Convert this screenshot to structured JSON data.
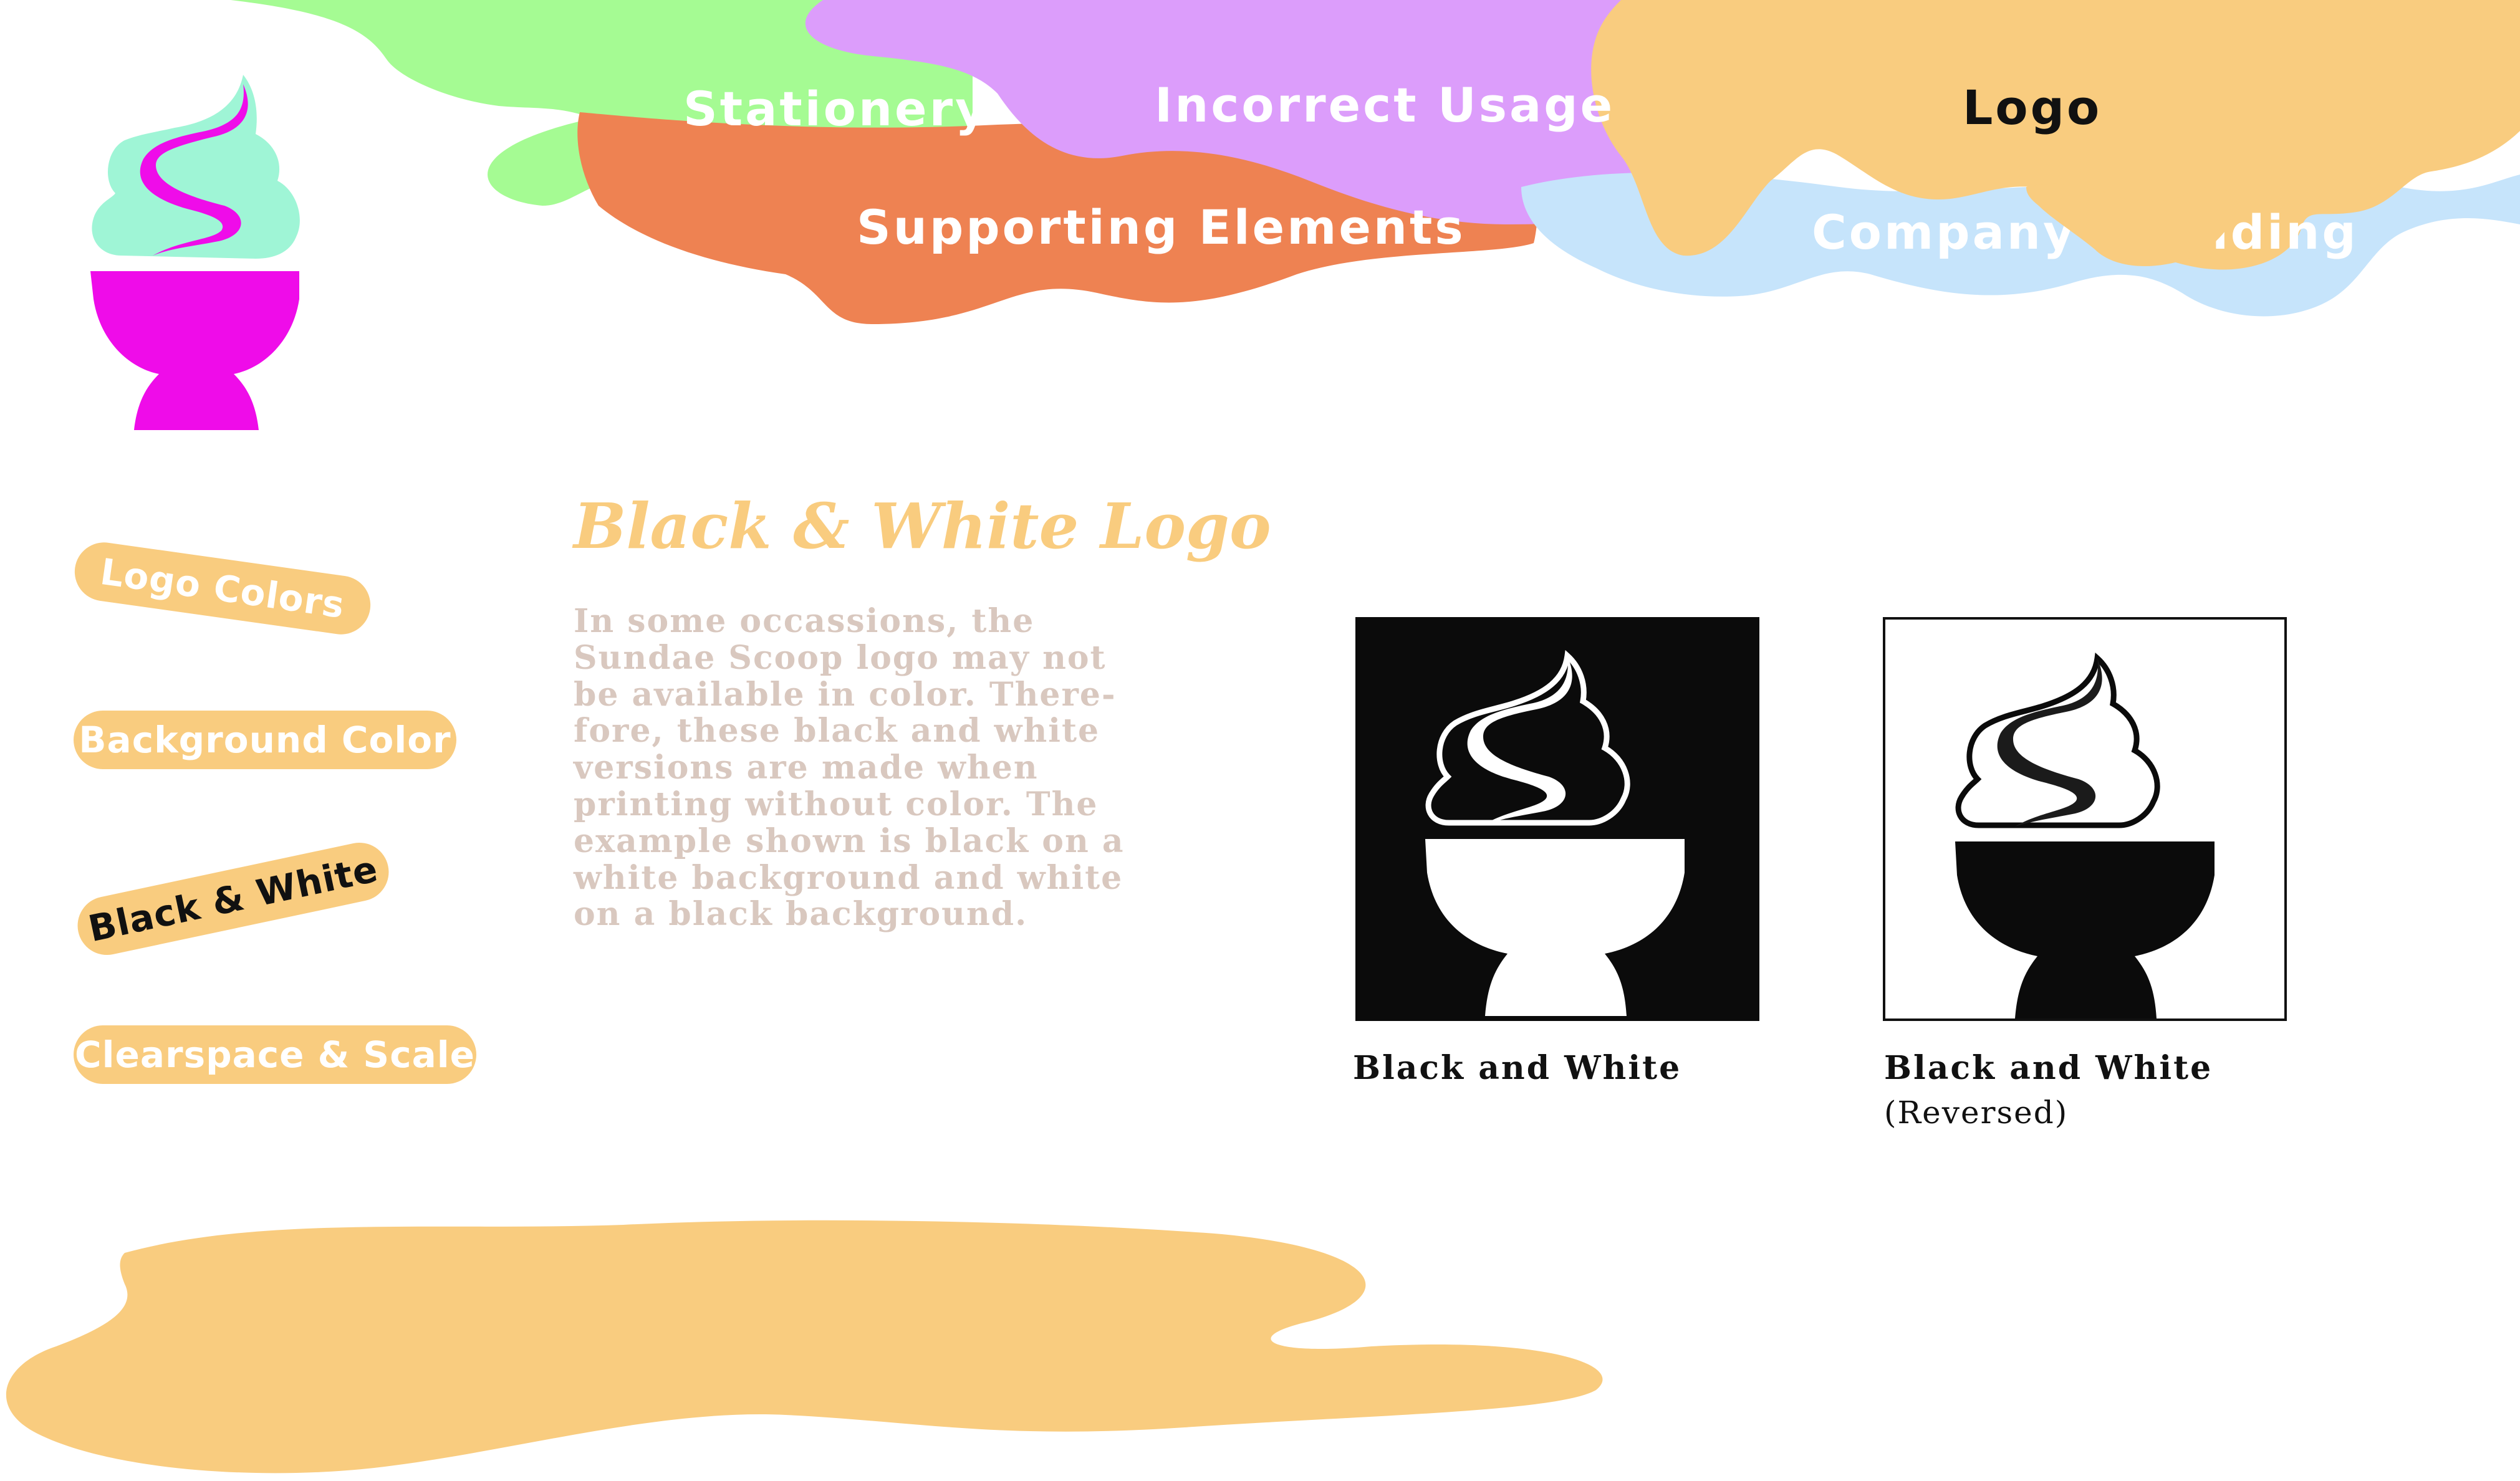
{
  "top_nav": {
    "stationery": "Stationery",
    "incorrect_usage": "Incorrect Usage",
    "logo": "Logo",
    "supporting_elements": "Supporting Elements",
    "company_branding": "Company Branding"
  },
  "side_nav": {
    "logo_colors": "Logo Colors",
    "background_color": "Background Color",
    "black_white": "Black & White",
    "clearspace_scale": "Clearspace & Scale"
  },
  "main": {
    "title": "Black & White Logo",
    "body_lines": [
      "In some occassions, the",
      "Sundae Scoop logo may not",
      "be available in color. There-",
      "fore, these black and white",
      "versions are made when",
      "printing without color. The",
      "example shown is black on a",
      "white background and white",
      "on a black background."
    ],
    "caption_bw": "Black and White",
    "caption_rev": "Black and White",
    "caption_rev_sub": "(Reversed)"
  },
  "colors": {
    "green": "#a5fb93",
    "purple": "#dc9dfb",
    "orange_tab": "#ee8252",
    "light_blue": "#c6e4fb",
    "cream": "#f9cc7f",
    "magenta": "#ef0ce9",
    "mint": "#9ff5d6",
    "body_text": "#d9c8bf"
  },
  "icons": {
    "brand_logo": "sundae-cup-icon",
    "bw_logo": "sundae-cup-icon",
    "bw_reversed_logo": "sundae-cup-icon"
  }
}
